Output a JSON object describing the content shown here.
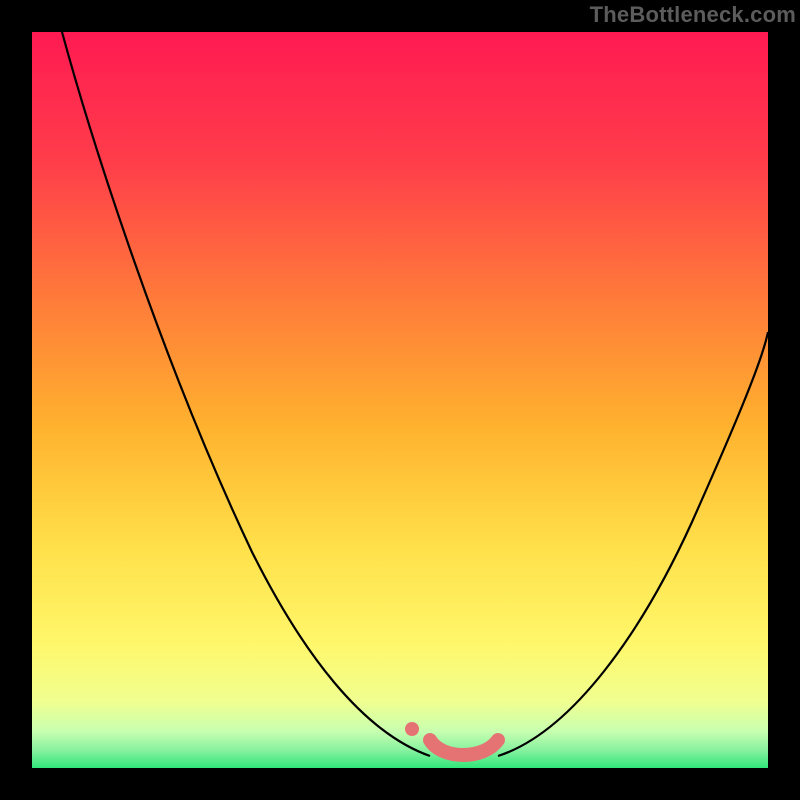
{
  "watermark": "TheBottleneck.com",
  "chart_data": {
    "type": "line",
    "title": "",
    "xlabel": "",
    "ylabel": "",
    "xlim": [
      0,
      100
    ],
    "ylim": [
      0,
      100
    ],
    "grid": false,
    "legend": false,
    "background_gradient": {
      "top": "#ff1a52",
      "upper_mid": "#ff5a3c",
      "mid": "#ffc030",
      "lower_mid": "#fff76a",
      "lower": "#f6ffa0",
      "bottom": "#30e67a"
    },
    "series": [
      {
        "name": "left-curve",
        "style": "black-thin",
        "x": [
          4,
          8,
          12,
          16,
          20,
          24,
          28,
          32,
          36,
          40,
          44,
          48,
          52,
          55
        ],
        "y": [
          100,
          90,
          80,
          70,
          60,
          50,
          41,
          32,
          24,
          17,
          11,
          6,
          2,
          0.5
        ]
      },
      {
        "name": "right-curve",
        "style": "black-thin",
        "x": [
          63,
          66,
          70,
          74,
          78,
          82,
          86,
          90,
          94,
          98,
          100
        ],
        "y": [
          0.5,
          2,
          5,
          9,
          14,
          20,
          27,
          35,
          44,
          54,
          60
        ]
      },
      {
        "name": "bottom-segment",
        "style": "salmon-thick",
        "x": [
          55,
          56.5,
          58,
          60,
          62,
          63
        ],
        "y": [
          3,
          1,
          0.5,
          0.5,
          1,
          3
        ]
      },
      {
        "name": "isolated-dot",
        "style": "salmon-dot",
        "x": [
          52.5
        ],
        "y": [
          5
        ]
      }
    ]
  }
}
